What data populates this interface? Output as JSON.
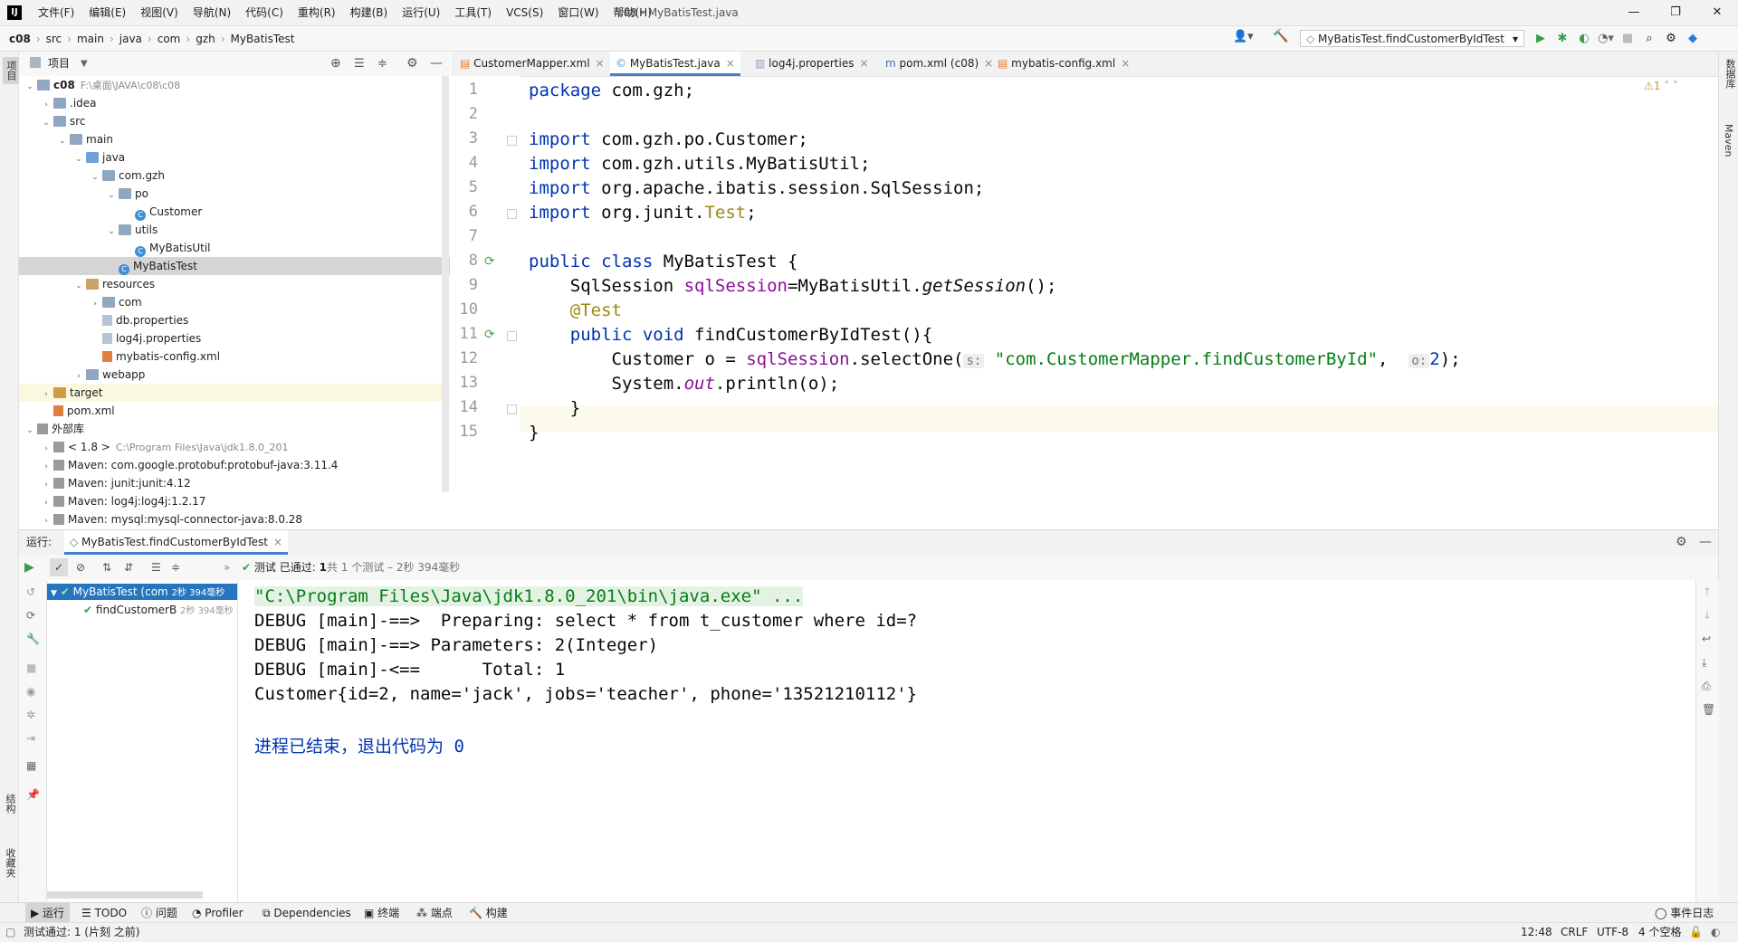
{
  "app": {
    "menu": [
      "文件(F)",
      "编辑(E)",
      "视图(V)",
      "导航(N)",
      "代码(C)",
      "重构(R)",
      "构建(B)",
      "运行(U)",
      "工具(T)",
      "VCS(S)",
      "窗口(W)",
      "帮助(H)"
    ],
    "window_title": "c08 - MyBatisTest.java"
  },
  "breadcrumb": [
    "c08",
    "src",
    "main",
    "java",
    "com",
    "gzh",
    "MyBatisTest"
  ],
  "run_config": "MyBatisTest.findCustomerByIdTest",
  "project_panel": {
    "title": "项目",
    "tree": [
      {
        "label": "c08",
        "extra": "F:\\桌面\\JAVA\\c08\\c08",
        "depth": 0,
        "icon": "folder",
        "expanded": true
      },
      {
        "label": ".idea",
        "depth": 1,
        "icon": "folder",
        "expanded": false
      },
      {
        "label": "src",
        "depth": 1,
        "icon": "folder",
        "expanded": true
      },
      {
        "label": "main",
        "depth": 2,
        "icon": "folder",
        "expanded": true
      },
      {
        "label": "java",
        "depth": 3,
        "icon": "folderb",
        "expanded": true
      },
      {
        "label": "com.gzh",
        "depth": 4,
        "icon": "folder",
        "expanded": true
      },
      {
        "label": "po",
        "depth": 5,
        "icon": "folder",
        "expanded": true
      },
      {
        "label": "Customer",
        "depth": 6,
        "icon": "cls"
      },
      {
        "label": "utils",
        "depth": 5,
        "icon": "folder",
        "expanded": true
      },
      {
        "label": "MyBatisUtil",
        "depth": 6,
        "icon": "cls"
      },
      {
        "label": "MyBatisTest",
        "depth": 5,
        "icon": "cls",
        "selected": true
      },
      {
        "label": "resources",
        "depth": 3,
        "icon": "folderr",
        "expanded": true
      },
      {
        "label": "com",
        "depth": 4,
        "icon": "folder",
        "expanded": false
      },
      {
        "label": "db.properties",
        "depth": 4,
        "icon": "file"
      },
      {
        "label": "log4j.properties",
        "depth": 4,
        "icon": "file"
      },
      {
        "label": "mybatis-config.xml",
        "depth": 4,
        "icon": "xml"
      },
      {
        "label": "webapp",
        "depth": 3,
        "icon": "folder",
        "expanded": false
      },
      {
        "label": "target",
        "depth": 1,
        "icon": "folderbrown",
        "expanded": false,
        "highlight": true
      },
      {
        "label": "pom.xml",
        "depth": 1,
        "icon": "xml"
      },
      {
        "label": "外部库",
        "depth": 0,
        "icon": "lib",
        "expanded": true
      },
      {
        "label": "< 1.8 >",
        "extra": "C:\\Program Files\\Java\\jdk1.8.0_201",
        "depth": 1,
        "icon": "lib",
        "expanded": false
      },
      {
        "label": "Maven: com.google.protobuf:protobuf-java:3.11.4",
        "depth": 1,
        "icon": "lib",
        "expanded": false
      },
      {
        "label": "Maven: junit:junit:4.12",
        "depth": 1,
        "icon": "lib",
        "expanded": false
      },
      {
        "label": "Maven: log4j:log4j:1.2.17",
        "depth": 1,
        "icon": "lib",
        "expanded": false
      },
      {
        "label": "Maven: mysql:mysql-connector-java:8.0.28",
        "depth": 1,
        "icon": "lib",
        "expanded": false
      }
    ]
  },
  "editor": {
    "tabs": [
      {
        "label": "CustomerMapper.xml",
        "icon": "xml"
      },
      {
        "label": "MyBatisTest.java",
        "icon": "cls",
        "active": true
      },
      {
        "label": "log4j.properties",
        "icon": "file"
      },
      {
        "label": "pom.xml (c08)",
        "icon": "maven"
      },
      {
        "label": "mybatis-config.xml",
        "icon": "xml"
      }
    ],
    "warnings": "⚠1",
    "line_numbers": [
      "1",
      "2",
      "3",
      "4",
      "5",
      "6",
      "7",
      "8",
      "9",
      "10",
      "11",
      "12",
      "13",
      "14",
      "15"
    ],
    "code": {
      "l1_kw": "package",
      "l1_rest": " com.gzh;",
      "l3_kw": "import",
      "l3_rest": " com.gzh.po.Customer;",
      "l4_kw": "import",
      "l4_rest": " com.gzh.utils.MyBatisUtil;",
      "l5_kw": "import",
      "l5_rest": " org.apache.ibatis.session.SqlSession;",
      "l6_kw": "import",
      "l6_rest": " org.junit.",
      "l6_test": "Test",
      "l6_end": ";",
      "l8_kw": "public class",
      "l8_rest": " MyBatisTest {",
      "l9_type": "SqlSession ",
      "l9_field": "sqlSession",
      "l9_eq": "=MyBatisUtil.",
      "l9_method": "getSession",
      "l9_end": "();",
      "l10_anno": "@Test",
      "l11_kw": "public void",
      "l11_rest": " findCustomerByIdTest(){",
      "l12_a": "Customer o = ",
      "l12_field": "sqlSession",
      "l12_b": ".selectOne(",
      "l12_hint1": "s:",
      "l12_str": "\"com.CustomerMapper.findCustomerById\"",
      "l12_c": ", ",
      "l12_hint2": "o:",
      "l12_num": "2",
      "l12_end": ");",
      "l13_a": "System.",
      "l13_out": "out",
      "l13_b": ".println(o);",
      "l14": "}",
      "l15": "}"
    }
  },
  "run_panel": {
    "label": "运行:",
    "tab": "MyBatisTest.findCustomerByIdTest",
    "status_prefix": "测试",
    "status_passed": "已通过:",
    "status_count": "1",
    "status_rest": "共 1 个测试 – 2秒 394毫秒",
    "tests": [
      {
        "label": "MyBatisTest (com",
        "time": "2秒 394毫秒"
      },
      {
        "label": "findCustomerB",
        "time": "2秒 394毫秒"
      }
    ],
    "console": [
      "\"C:\\Program Files\\Java\\jdk1.8.0_201\\bin\\java.exe\" ...",
      "DEBUG [main]-==>  Preparing: select * from t_customer where id=?",
      "DEBUG [main]-==> Parameters: 2(Integer)",
      "DEBUG [main]-<==      Total: 1",
      "Customer{id=2, name='jack', jobs='teacher', phone='13521210112'}",
      "",
      "进程已结束，退出代码为 0"
    ]
  },
  "bottom_tabs": [
    "运行",
    "TODO",
    "问题",
    "Profiler",
    "Dependencies",
    "终端",
    "端点",
    "构建"
  ],
  "event_log": "事件日志",
  "left_stripe": [
    "项目",
    "结构",
    "收藏夹"
  ],
  "right_stripe": [
    "数据库",
    "Maven"
  ],
  "status": {
    "message": "测试通过: 1 (片刻 之前)",
    "position": "12:48",
    "line_sep": "CRLF",
    "encoding": "UTF-8",
    "indent": "4 个空格"
  }
}
